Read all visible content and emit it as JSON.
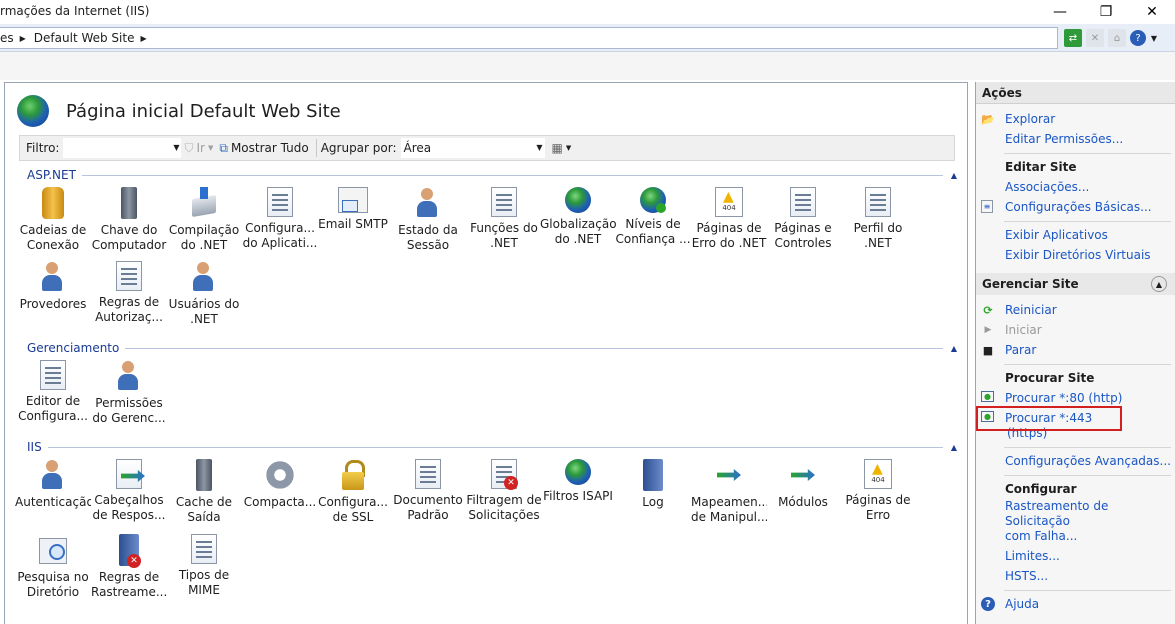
{
  "window": {
    "title": "rmações da Internet (IIS)",
    "minimize": "—",
    "maximize": "❐",
    "close": "✕"
  },
  "address": {
    "crumbs": [
      "es",
      "Default Web Site"
    ]
  },
  "header": {
    "title": "Página inicial Default Web Site"
  },
  "filterbar": {
    "filter_label": "Filtro:",
    "go_label": "Ir",
    "show_all_label": "Mostrar Tudo",
    "group_by_label": "Agrupar por:",
    "group_by_value": "Área"
  },
  "groups": {
    "aspnet": "ASP.NET",
    "management": "Gerenciamento",
    "iis": "IIS"
  },
  "features": {
    "aspnet": [
      [
        "Cadeias de",
        "Conexão"
      ],
      [
        "Chave do",
        "Computador"
      ],
      [
        "Compilação",
        "do .NET"
      ],
      [
        "Configura...",
        "do Aplicati..."
      ],
      [
        "Email SMTP",
        ""
      ],
      [
        "Estado da",
        "Sessão"
      ],
      [
        "Funções do",
        ".NET"
      ],
      [
        "Globalização",
        "do .NET"
      ],
      [
        "Níveis de",
        "Confiança ..."
      ],
      [
        "Páginas de",
        "Erro do .NET"
      ],
      [
        "Páginas e",
        "Controles"
      ],
      [
        "Perfil do",
        ".NET"
      ],
      [
        "Provedores",
        ""
      ],
      [
        "Regras de",
        "Autorizaç..."
      ],
      [
        "Usuários do",
        ".NET"
      ]
    ],
    "management": [
      [
        "Editor de",
        "Configura..."
      ],
      [
        "Permissões",
        "do Gerenc..."
      ]
    ],
    "iis": [
      [
        "Autenticação",
        ""
      ],
      [
        "Cabeçalhos",
        "de Respos..."
      ],
      [
        "Cache de",
        "Saída"
      ],
      [
        "Compacta...",
        ""
      ],
      [
        "Configura...",
        "de SSL"
      ],
      [
        "Documento",
        "Padrão"
      ],
      [
        "Filtragem de",
        "Solicitações"
      ],
      [
        "Filtros ISAPI",
        ""
      ],
      [
        "Log",
        ""
      ],
      [
        "Mapeamen...",
        "de Manipul..."
      ],
      [
        "Módulos",
        ""
      ],
      [
        "Páginas de",
        "Erro"
      ],
      [
        "Pesquisa no",
        "Diretório"
      ],
      [
        "Regras de",
        "Rastreame..."
      ],
      [
        "Tipos de",
        "MIME"
      ]
    ]
  },
  "actions": {
    "title": "Ações",
    "explore": "Explorar",
    "edit_permissions": "Editar Permissões...",
    "edit_site": "Editar Site",
    "bindings": "Associações...",
    "basic_settings": "Configurações Básicas...",
    "view_apps": "Exibir Aplicativos",
    "view_vdirs": "Exibir Diretórios Virtuais",
    "manage_site": "Gerenciar Site",
    "restart": "Reiniciar",
    "start": "Iniciar",
    "stop": "Parar",
    "browse_site": "Procurar Site",
    "browse_80": "Procurar *:80 (http)",
    "browse_443": "Procurar *:443 (https)",
    "advanced_settings": "Configurações Avançadas...",
    "configure": "Configurar",
    "failed_request_tracing": [
      "Rastreamento de Solicitação",
      "com Falha..."
    ],
    "limits": "Limites...",
    "hsts": "HSTS...",
    "help": "Ajuda"
  }
}
